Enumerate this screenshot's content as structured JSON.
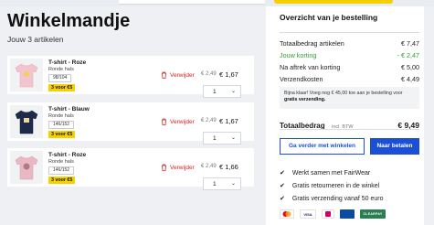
{
  "page": {
    "title": "Winkelmandje",
    "item_count_text": "Jouw 3 artikelen"
  },
  "items": [
    {
      "name": "T-shirt - Roze",
      "subtitle": "Ronde hals",
      "size": "98/104",
      "promo": "3 voor €5",
      "old_price": "€ 2,49",
      "price": "€ 1,67",
      "remove_label": "Verwijder",
      "quantity": "1",
      "shirt_color": "#f2c4cf",
      "print_color": "#f0d15a"
    },
    {
      "name": "T-shirt - Blauw",
      "subtitle": "Ronde hals",
      "size": "146/152",
      "promo": "3 voor €5",
      "old_price": "€ 2,49",
      "price": "€ 1,67",
      "remove_label": "Verwijder",
      "quantity": "1",
      "shirt_color": "#1e2a4a",
      "print_color": "#e8d8a0"
    },
    {
      "name": "T-shirt - Roze",
      "subtitle": "Ronde hals",
      "size": "146/152",
      "promo": "3 voor €5",
      "old_price": "€ 2,49",
      "price": "€ 1,66",
      "remove_label": "Verwijder",
      "quantity": "1",
      "shirt_color": "#e9b8c2",
      "print_color": "#b07a84"
    }
  ],
  "summary": {
    "title": "Overzicht van je bestelling",
    "rows": [
      {
        "label": "Totaalbedrag artikelen",
        "value": "€ 7,47"
      },
      {
        "label": "Jouw korting",
        "value": "- € 2,47"
      },
      {
        "label": "Na aftrek van korting",
        "value": "€ 5,00"
      },
      {
        "label": "Verzendkosten",
        "value": "€ 4,49"
      }
    ],
    "info_text": "Bijna klaar! Voeg nog € 45,00 toe aan je bestelling voor",
    "info_bold": "gratis verzending.",
    "total_label": "Totaalbedrag",
    "total_vat": "incl. BTW",
    "total_value": "€ 9,49",
    "continue_button": "Ga verder met winkelen",
    "pay_button": "Naar betalen",
    "usps": [
      "Werkt samen met FairWear",
      "Gratis retourneren in de winkel",
      "Gratis verzending vanaf 50 euro"
    ],
    "payment_logos": [
      "mastercard",
      "VISA",
      "iDEAL",
      "bancontact",
      "CLEARPAY"
    ]
  },
  "colors": {
    "accent_blue": "#1b4fd6",
    "remove_red": "#d2231e",
    "promo_yellow": "#f7d000",
    "discount_green": "#2f9e2f"
  }
}
